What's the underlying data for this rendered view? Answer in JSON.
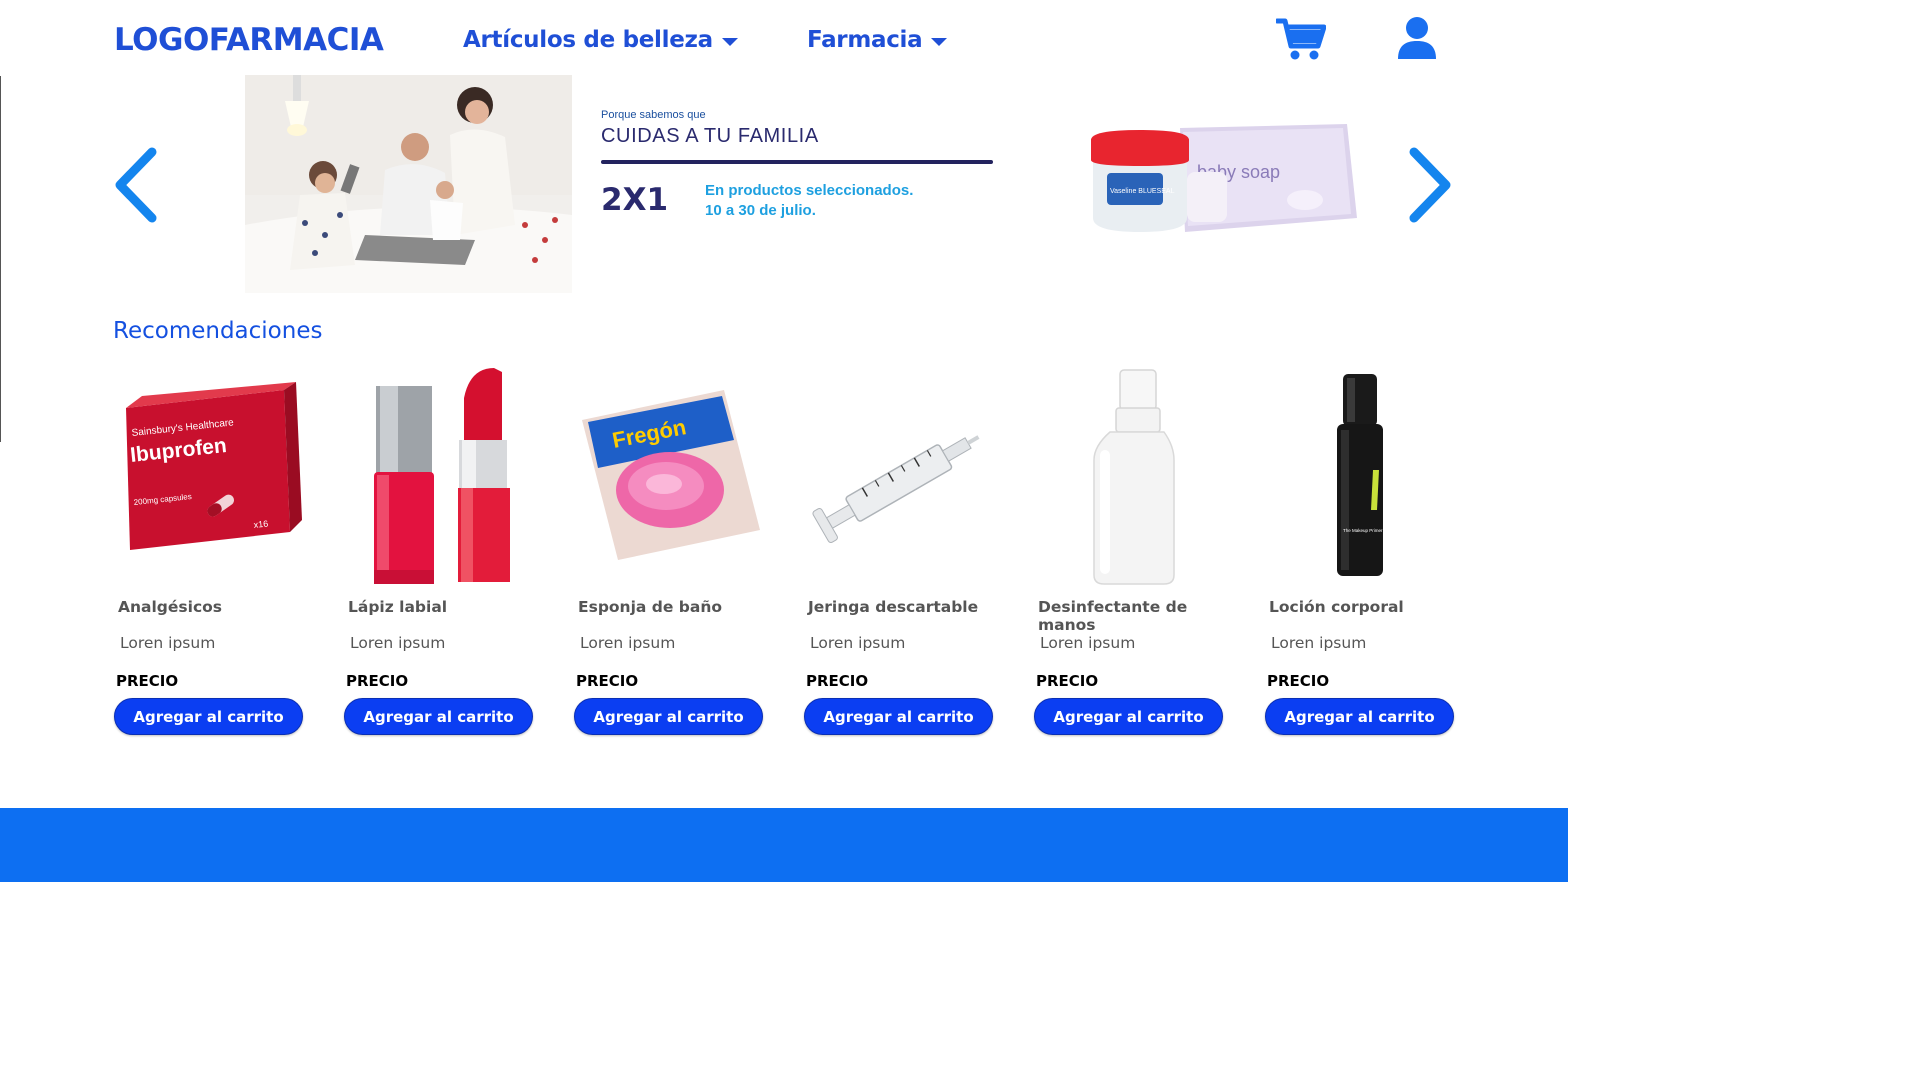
{
  "header": {
    "logo": "LOGOFARMACIA",
    "nav": [
      {
        "label": "Artículos de belleza"
      },
      {
        "label": "Farmacia"
      }
    ]
  },
  "banner": {
    "small_text": "Porque sabemos que",
    "title": "CUIDAS A TU FAMILIA",
    "offer": "2X1",
    "desc_line1": "En productos seleccionados.",
    "desc_line2": "10 a 30 de julio."
  },
  "recommendations": {
    "title": "Recomendaciones",
    "products": [
      {
        "name": "Analgésicos",
        "desc": "Loren ipsum",
        "price": "PRECIO",
        "button": "Agregar al carrito",
        "image": "ibuprofen-box"
      },
      {
        "name": "Lápiz labial",
        "desc": "Loren ipsum",
        "price": "PRECIO",
        "button": "Agregar al carrito",
        "image": "lipstick"
      },
      {
        "name": "Esponja de baño",
        "desc": "Loren ipsum",
        "price": "PRECIO",
        "button": "Agregar al carrito",
        "image": "sponge"
      },
      {
        "name": "Jeringa descartable",
        "desc": "Loren ipsum",
        "price": "PRECIO",
        "button": "Agregar al carrito",
        "image": "syringe"
      },
      {
        "name": "Desinfectante de manos",
        "desc": "Loren ipsum",
        "price": "PRECIO",
        "button": "Agregar al carrito",
        "image": "spray-bottle"
      },
      {
        "name": "Loción corporal",
        "desc": "Loren ipsum",
        "price": "PRECIO",
        "button": "Agregar al carrito",
        "image": "black-spray"
      }
    ]
  },
  "image_text": {
    "ibuprofen_brand": "Sainsbury's Healthcare",
    "ibuprofen_name": "Ibuprofen",
    "ibuprofen_dose": "200mg capsules",
    "ibuprofen_count": "x16",
    "sponge_brand": "Fregón",
    "soap_label": "baby soap",
    "vaseline_label": "Vaseline BLUESEAL",
    "primer_label": "The Makeup Primer Spray"
  },
  "colors": {
    "brand_blue": "#1f4fd6",
    "button_blue": "#0b3ef2",
    "arrow_blue": "#1485ee",
    "footer_blue": "#0d6ff2",
    "banner_navy": "#2a2a6e",
    "banner_cyan": "#1ea0e0"
  },
  "icons": [
    "cart-icon",
    "user-icon",
    "chevron-left-icon",
    "chevron-right-icon",
    "caret-down-icon"
  ]
}
